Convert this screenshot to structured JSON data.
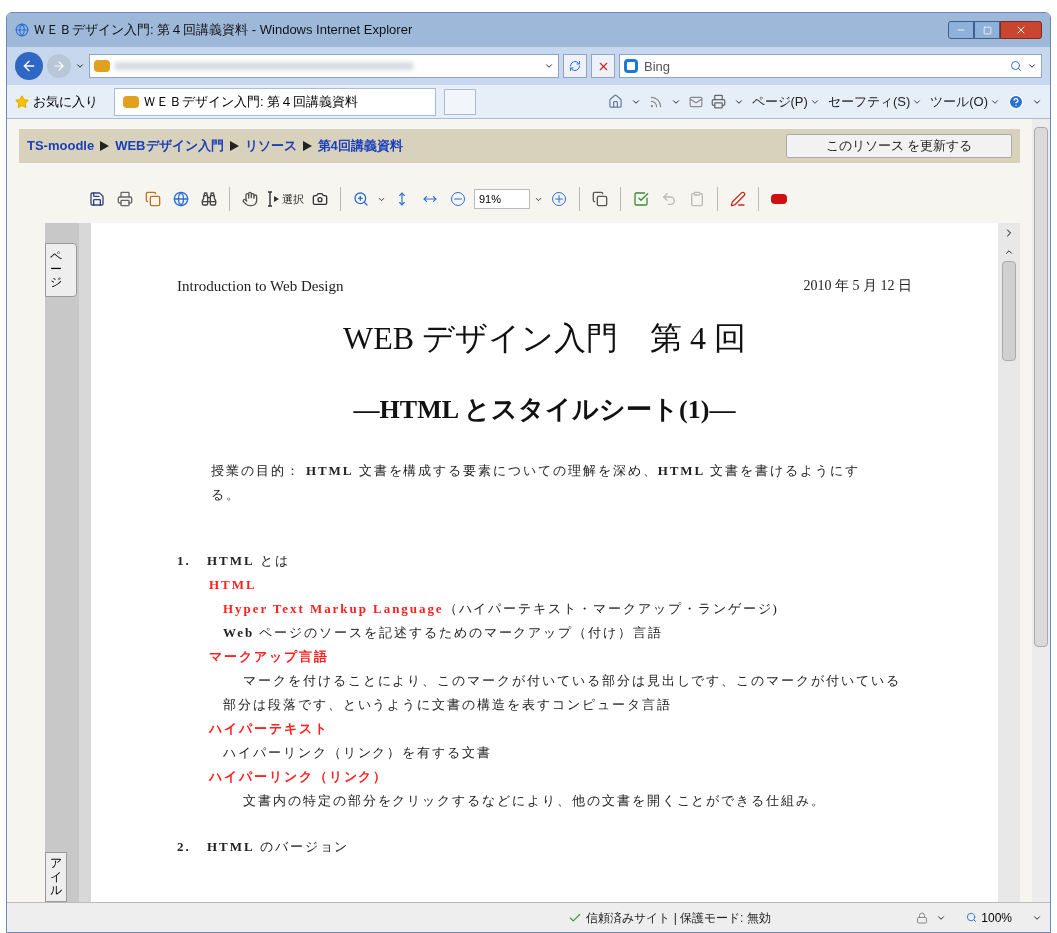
{
  "window": {
    "title": "ＷＥＢデザイン入門: 第４回講義資料 - Windows Internet Explorer"
  },
  "address_bar": {
    "search_placeholder": "Bing"
  },
  "favorites_bar": {
    "favorites": "お気に入り",
    "tab_title": "ＷＥＢデザイン入門: 第４回講義資料"
  },
  "command_bar": {
    "menus": [
      "ページ(P)",
      "セーフティ(S)",
      "ツール(O)"
    ]
  },
  "breadcrumb": [
    "TS-moodle",
    "WEBデザイン入門",
    "リソース",
    "第4回講義資料"
  ],
  "update_button": "このリソース を更新する",
  "pdf_toolbar": {
    "select_label": "選択",
    "zoom": "91%"
  },
  "side_tabs": [
    "ページ",
    "アイル"
  ],
  "document": {
    "header_left": "Introduction to Web Design",
    "header_right": "2010 年 5 月 12 日",
    "title": "WEB デザイン入門　第 4 回",
    "subtitle": "—HTML とスタイルシート(1)—",
    "blocks": [
      {
        "kind": "purpose",
        "text": "授業の目的： **HTML** 文書を構成する要素についての理解を深め、**HTML** 文書を書けるようにする。"
      },
      {
        "kind": "heading",
        "number": "1.",
        "text": "**HTML** とは"
      },
      {
        "kind": "term",
        "text": "HTML"
      },
      {
        "kind": "term_def",
        "term": "Hyper Text Markup Language",
        "text": "（ハイパーテキスト・マークアップ・ランゲージ)"
      },
      {
        "kind": "desc",
        "text": "**Web** ページのソースを記述するためのマークアップ（付け）言語"
      },
      {
        "kind": "term",
        "text": "マークアップ言語"
      },
      {
        "kind": "desc_indent",
        "text": "マークを付けることにより、このマークが付いている部分は見出しです、このマークが付いている部分は段落です、というように文書の構造を表すコンピュータ言語"
      },
      {
        "kind": "term",
        "text": "ハイパーテキスト"
      },
      {
        "kind": "desc",
        "text": "ハイパーリンク（リンク）を有する文書"
      },
      {
        "kind": "term",
        "text": "ハイパーリンク（リンク）"
      },
      {
        "kind": "desc_indent",
        "text": "文書内の特定の部分をクリックするなどにより、他の文書を開くことができる仕組み。"
      },
      {
        "kind": "heading",
        "number": "2.",
        "text": "**HTML** のバージョン"
      }
    ]
  },
  "status_bar": {
    "zone": "信頼済みサイト | 保護モード: 無効",
    "zoom": "100%"
  }
}
